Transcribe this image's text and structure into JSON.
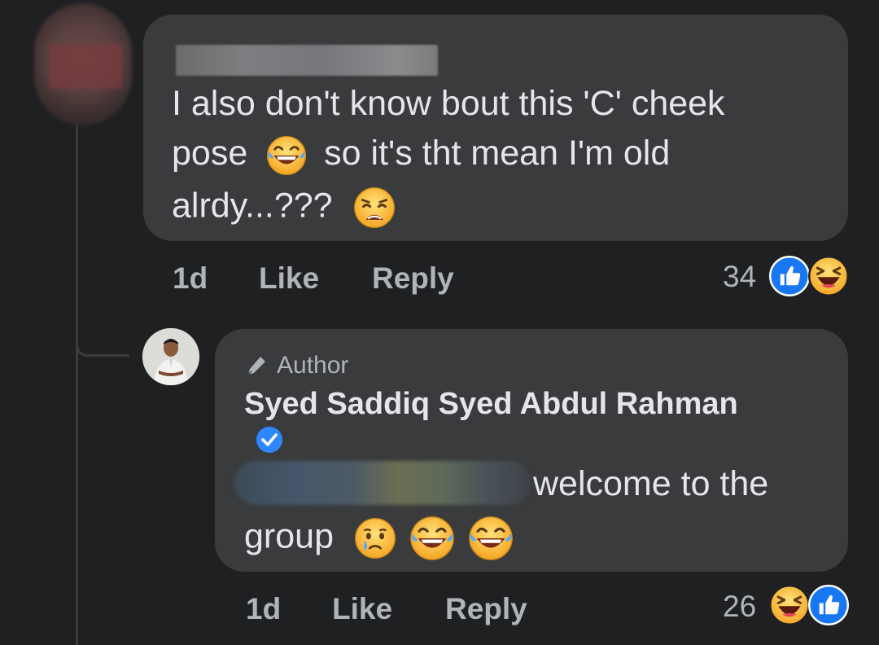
{
  "comment": {
    "text_line1": "I also don't know bout this 'C' cheek",
    "text_line2_a": "pose",
    "text_line2_b": "so it's tht mean I'm old",
    "text_line3": "alrdy...???",
    "time": "1d",
    "like_label": "Like",
    "reply_label": "Reply",
    "reaction_count": "34"
  },
  "reply": {
    "badge_label": "Author",
    "author_name": "Syed Saddiq Syed Abdul Rahman",
    "text_part1": "welcome to the",
    "text_part2": "group",
    "time": "1d",
    "like_label": "Like",
    "reply_label": "Reply",
    "reaction_count": "26"
  },
  "colors": {
    "background": "#1f2022",
    "bubble": "#3a3b3c",
    "text": "#e4e6eb",
    "secondary_text": "#b0b3b8",
    "like_blue": "#1877f2",
    "emoji_yellow": "#f7c531"
  },
  "icons": {
    "comment_reactions": [
      "like-icon",
      "haha-icon"
    ],
    "reply_reactions": [
      "haha-icon",
      "like-icon"
    ],
    "comment_emojis": [
      "tears-of-joy-emoji",
      "weary-emoji"
    ],
    "reply_emojis": [
      "crying-emoji",
      "tears-of-joy-emoji",
      "tears-of-joy-emoji"
    ],
    "author_badge_icon": "pen-icon",
    "verified_icon": "verified-check-icon"
  }
}
